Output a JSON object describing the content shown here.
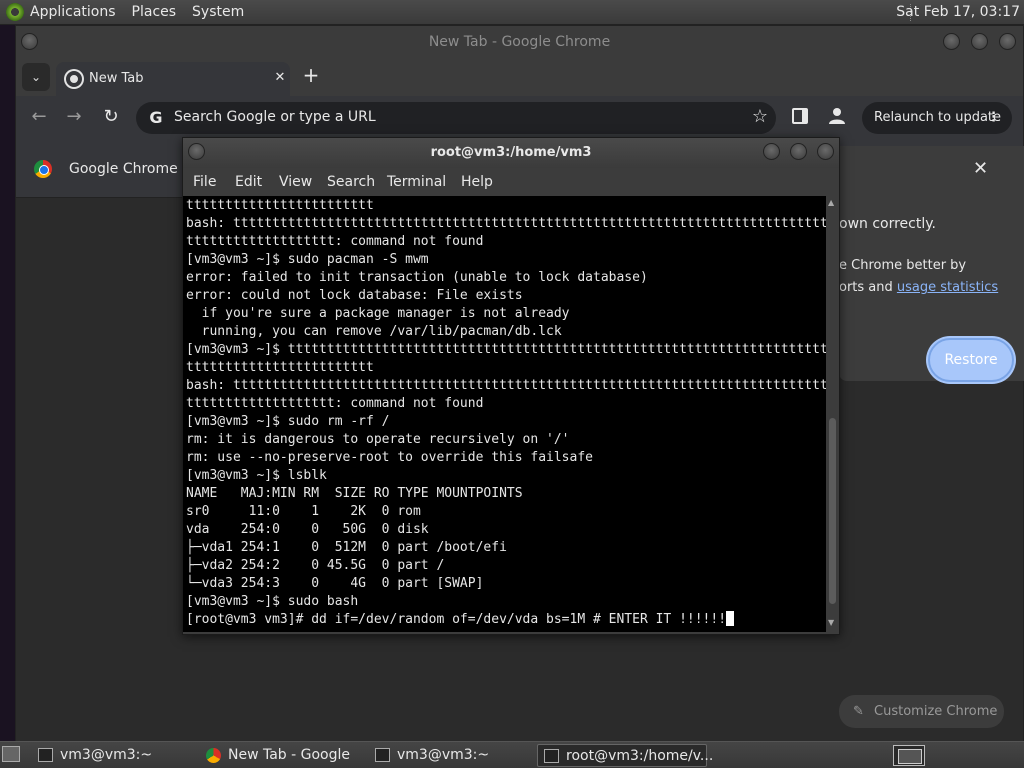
{
  "top_panel": {
    "menus": [
      "Applications",
      "Places",
      "System"
    ],
    "clock": "Sat Feb 17, 03:17"
  },
  "chrome": {
    "window_title": "New Tab - Google Chrome",
    "tab_title": "New Tab",
    "tab_close": "✕",
    "new_tab": "+",
    "omnibox_placeholder": "Search Google or type a URL",
    "relaunch_label": "Relaunch to update",
    "infobar_text": "Google Chrome isn",
    "restore_bubble": {
      "line1": "own correctly.",
      "line2": "e Chrome better by",
      "line3_prefix": "orts and ",
      "line3_link": "usage statistics",
      "restore_label": "Restore"
    },
    "customize_label": "Customize Chrome"
  },
  "terminal": {
    "window_title": "root@vm3:/home/vm3",
    "menus": [
      "File",
      "Edit",
      "View",
      "Search",
      "Terminal",
      "Help"
    ],
    "lines": [
      "tttttttttttttttttttttttt",
      "bash: tttttttttttttttttttttttttttttttttttttttttttttttttttttttttttttttttttttttttttttt",
      "ttttttttttttttttttt: command not found",
      "[vm3@vm3 ~]$ sudo pacman -S mwm",
      "error: failed to init transaction (unable to lock database)",
      "error: could not lock database: File exists",
      "  if you're sure a package manager is not already",
      "  running, you can remove /var/lib/pacman/db.lck",
      "[vm3@vm3 ~]$ tttttttttttttttttttttttttttttttttttttttttttttttttttttttttttttttttttttttttttttt",
      "tttttttttttttttttttttttt",
      "bash: tttttttttttttttttttttttttttttttttttttttttttttttttttttttttttttttttttttttttttttt",
      "ttttttttttttttttttt: command not found",
      "[vm3@vm3 ~]$ sudo rm -rf /",
      "rm: it is dangerous to operate recursively on '/'",
      "rm: use --no-preserve-root to override this failsafe",
      "[vm3@vm3 ~]$ lsblk",
      "NAME   MAJ:MIN RM  SIZE RO TYPE MOUNTPOINTS",
      "sr0     11:0    1    2K  0 rom",
      "vda    254:0    0   50G  0 disk",
      "├─vda1 254:1    0  512M  0 part /boot/efi",
      "├─vda2 254:2    0 45.5G  0 part /",
      "└─vda3 254:3    0    4G  0 part [SWAP]",
      "[vm3@vm3 ~]$ sudo bash"
    ],
    "current_line": "[root@vm3 vm3]# dd if=/dev/random of=/dev/vda bs=1M # ENTER IT !!!!!!"
  },
  "taskbar": {
    "tasks": [
      "vm3@vm3:~",
      "New Tab - Google ...",
      "vm3@vm3:~",
      "root@vm3:/home/v..."
    ]
  }
}
